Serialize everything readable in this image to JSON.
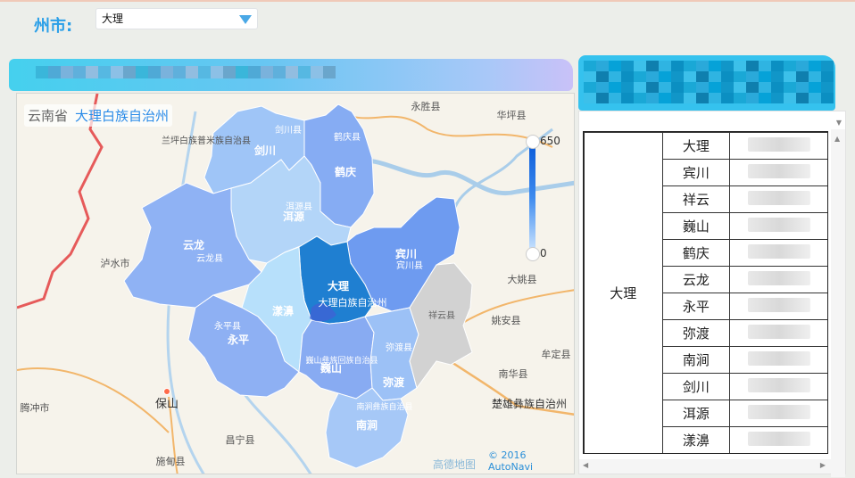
{
  "filter": {
    "label": "州市:",
    "selected": "大理"
  },
  "map": {
    "breadcrumb_province": "云南省",
    "breadcrumb_prefecture": "大理白族自治州",
    "legend_max": "650",
    "legend_min": "0",
    "copyright": "© 2016 AutoNavi",
    "logo_text": "高德地图",
    "base_labels": {
      "yongsheng": "永胜县",
      "huaping": "华坪县",
      "lanping": "兰坪白族普米族自治县",
      "lushui": "泸水市",
      "tengchong": "腾冲市",
      "baoshan": "保山",
      "changning": "昌宁县",
      "shidian": "施甸县",
      "dayao": "大姚县",
      "yaoan": "姚安县",
      "mouding": "牟定县",
      "nanhua": "南华县",
      "chuxiong": "楚雄彝族自治州",
      "jianchuan_county": "剑川县",
      "yun_county": "云龙县",
      "yongping_county": "永平县",
      "eryuan_county": "洱源县",
      "binchuan_county": "宾川县",
      "dali_county": "大理白族自治州",
      "weishan_county": "巍山彝族回族自治县",
      "midu_county": "弥渡县",
      "nanjian_county": "南涧彝族自治县",
      "heqing_county": "鹤庆县",
      "yunlong_county": "云龙县",
      "xiangyun_county": "祥云县"
    },
    "regions": {
      "jianchuan": "剑川",
      "heqing": "鹤庆",
      "eryuan": "洱源",
      "yunlong": "云龙",
      "binchuan": "宾川",
      "dali": "大理",
      "yangbi": "漾濞",
      "yongping": "永平",
      "weishan": "巍山",
      "midu": "弥渡",
      "nanjian": "南涧",
      "xiangyun": "祥云"
    },
    "colors": {
      "dali": "#1f7fd1",
      "binchuan": "#6e9bf0",
      "heqing": "#86acf3",
      "yunlong": "#8fb2f4",
      "jianchuan": "#9fc5f7",
      "eryuan": "#b3d5f8",
      "yangbi": "#b7e0fb",
      "yongping": "#8eb0f3",
      "weishan": "#88abf2",
      "midu": "#9cc1f6",
      "nanjian": "#a6c8f7",
      "xiangyun": "#d2d2d2",
      "dali_lake": "#3e63d4"
    }
  },
  "table": {
    "city": "大理",
    "counties": [
      "大理",
      "宾川",
      "祥云",
      "巍山",
      "鹤庆",
      "云龙",
      "永平",
      "弥渡",
      "南涧",
      "剑川",
      "洱源",
      "漾濞"
    ]
  }
}
